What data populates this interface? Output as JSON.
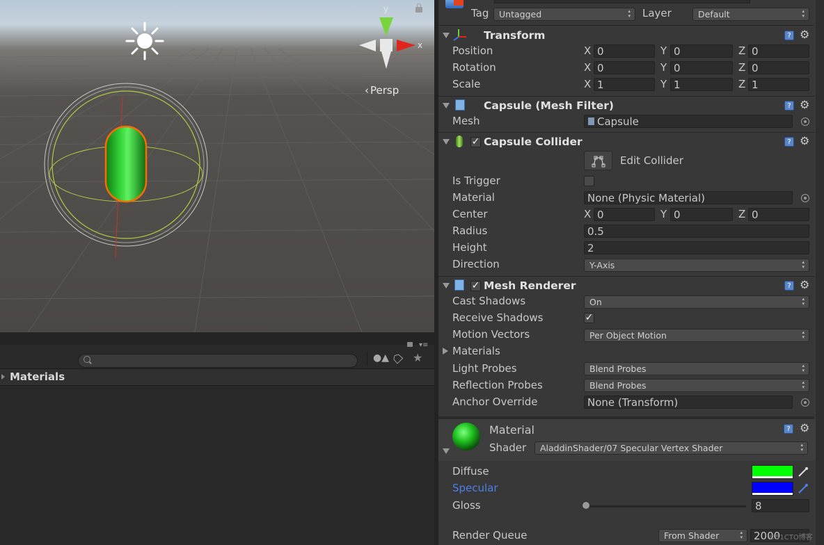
{
  "scene": {
    "axis_y": "y",
    "axis_x": "x",
    "projection": "Persp"
  },
  "project": {
    "search_placeholder": "",
    "folder": "Materials"
  },
  "inspector": {
    "tag_label": "Tag",
    "tag_value": "Untagged",
    "layer_label": "Layer",
    "layer_value": "Default",
    "transform": {
      "title": "Transform",
      "position_label": "Position",
      "rotation_label": "Rotation",
      "scale_label": "Scale",
      "position": {
        "x": "0",
        "y": "0",
        "z": "0"
      },
      "rotation": {
        "x": "0",
        "y": "0",
        "z": "0"
      },
      "scale": {
        "x": "1",
        "y": "1",
        "z": "1"
      }
    },
    "axis_labels": {
      "x": "X",
      "y": "Y",
      "z": "Z"
    },
    "mesh_filter": {
      "title": "Capsule (Mesh Filter)",
      "mesh_label": "Mesh",
      "mesh_value": "Capsule"
    },
    "collider": {
      "title": "Capsule Collider",
      "edit_label": "Edit Collider",
      "is_trigger_label": "Is Trigger",
      "material_label": "Material",
      "material_value": "None (Physic Material)",
      "center_label": "Center",
      "center": {
        "x": "0",
        "y": "0",
        "z": "0"
      },
      "radius_label": "Radius",
      "radius_value": "0.5",
      "height_label": "Height",
      "height_value": "2",
      "direction_label": "Direction",
      "direction_value": "Y-Axis"
    },
    "renderer": {
      "title": "Mesh Renderer",
      "cast_shadows_label": "Cast Shadows",
      "cast_shadows_value": "On",
      "receive_shadows_label": "Receive Shadows",
      "motion_vectors_label": "Motion Vectors",
      "motion_vectors_value": "Per Object Motion",
      "materials_label": "Materials",
      "light_probes_label": "Light Probes",
      "light_probes_value": "Blend Probes",
      "reflection_probes_label": "Reflection Probes",
      "reflection_probes_value": "Blend Probes",
      "anchor_label": "Anchor Override",
      "anchor_value": "None (Transform)"
    },
    "material": {
      "title": "Material",
      "shader_label": "Shader",
      "shader_value": "AladdinShader/07 Specular Vertex Shader",
      "diffuse_label": "Diffuse",
      "diffuse_color": "#00ff00",
      "specular_label": "Specular",
      "specular_color": "#0000ff",
      "gloss_label": "Gloss",
      "gloss_value": "8",
      "gloss_fraction": 0.0,
      "render_queue_label": "Render Queue",
      "render_queue_mode": "From Shader",
      "render_queue_value": "2000"
    }
  },
  "watermark": "©51CTO博客"
}
